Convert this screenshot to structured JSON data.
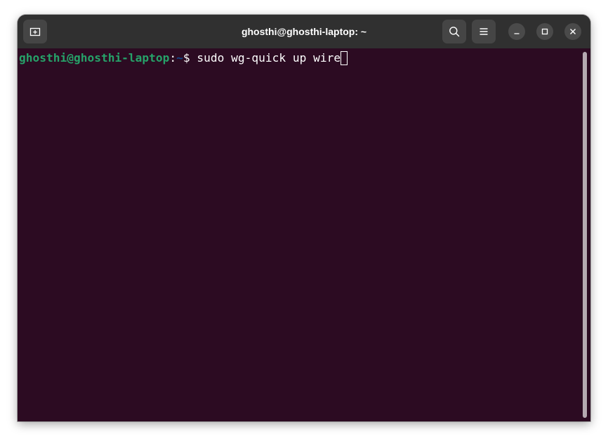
{
  "window": {
    "title": "ghosthi@ghosthi-laptop: ~"
  },
  "toolbar": {
    "new_tab_icon": "new-tab-icon",
    "search_icon": "search-icon",
    "menu_icon": "hamburger-menu-icon",
    "minimize_icon": "minimize-icon",
    "maximize_icon": "maximize-icon",
    "close_icon": "close-icon"
  },
  "terminal": {
    "prompt_user": "ghosthi@ghosthi-laptop",
    "prompt_colon": ":",
    "prompt_path": "~",
    "prompt_symbol": "$ ",
    "command": "sudo wg-quick up wire"
  },
  "colors": {
    "terminal_bg": "#2c0b22",
    "titlebar_bg": "#303030",
    "prompt_user": "#26a269",
    "prompt_path": "#12488b",
    "text": "#ffffff"
  }
}
